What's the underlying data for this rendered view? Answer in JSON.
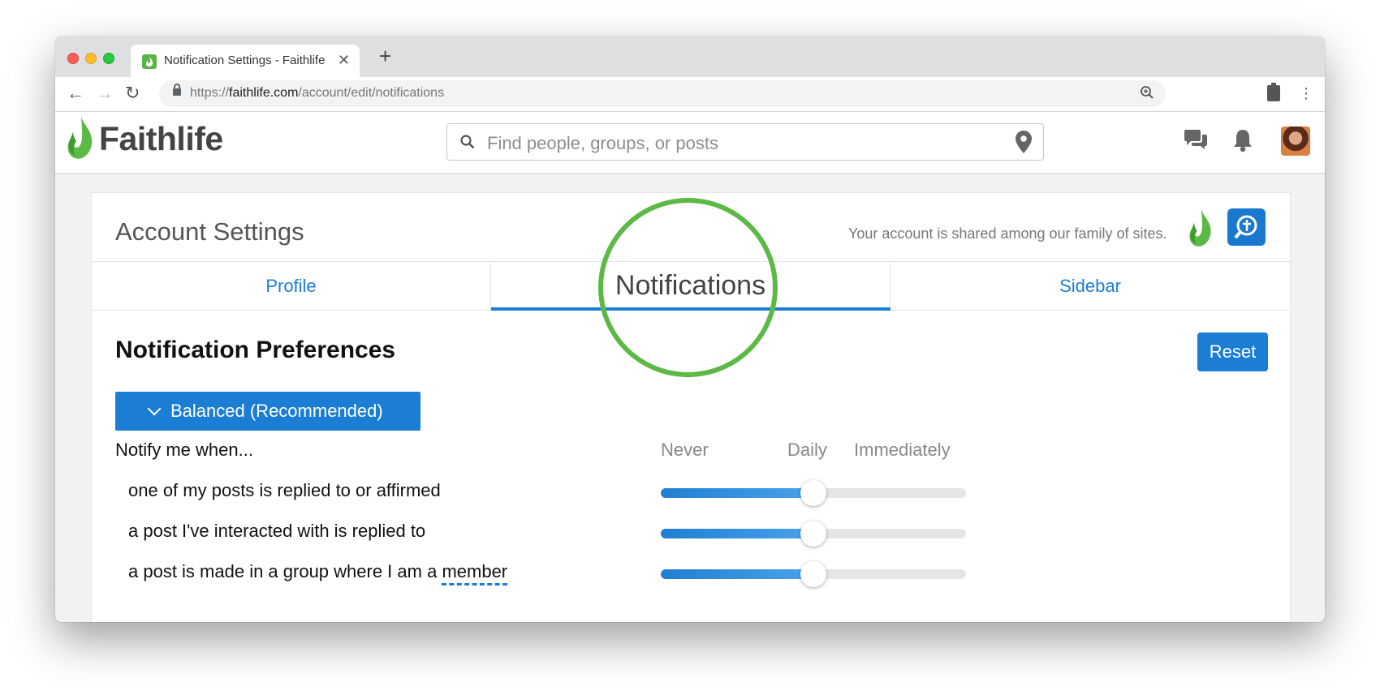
{
  "browser": {
    "tab_title": "Notification Settings - Faithlife",
    "tab_close": "✕",
    "new_tab": "+",
    "url_scheme": "https://",
    "url_host": "faithlife.com",
    "url_path": "/account/edit/notifications"
  },
  "site": {
    "logo_text": "Faithlife",
    "search_placeholder": "Find people, groups, or posts",
    "brand_green": "#5cb946",
    "accent_blue": "#1b7ed4"
  },
  "account": {
    "title": "Account Settings",
    "shared_note": "Your account is shared among our family of sites.",
    "tabs": [
      {
        "label": "Profile",
        "active": false
      },
      {
        "label": "Notifications",
        "active": true
      },
      {
        "label": "Sidebar",
        "active": false
      }
    ]
  },
  "notifications": {
    "section_title": "Notification Preferences",
    "reset_label": "Reset",
    "preset_label": "Balanced (Recommended)",
    "notify_label": "Notify me when...",
    "scale_labels": [
      "Never",
      "Daily",
      "Immediately"
    ],
    "rows": [
      {
        "label": "one of my posts is replied to or affirmed",
        "level": 0.5,
        "level_label": "Daily"
      },
      {
        "label": "a post I've interacted with is replied to",
        "level": 0.5,
        "level_label": "Daily"
      },
      {
        "label": "a post is made in a group where I am a",
        "link": "member",
        "level": 0.5,
        "level_label": "Daily"
      }
    ]
  }
}
